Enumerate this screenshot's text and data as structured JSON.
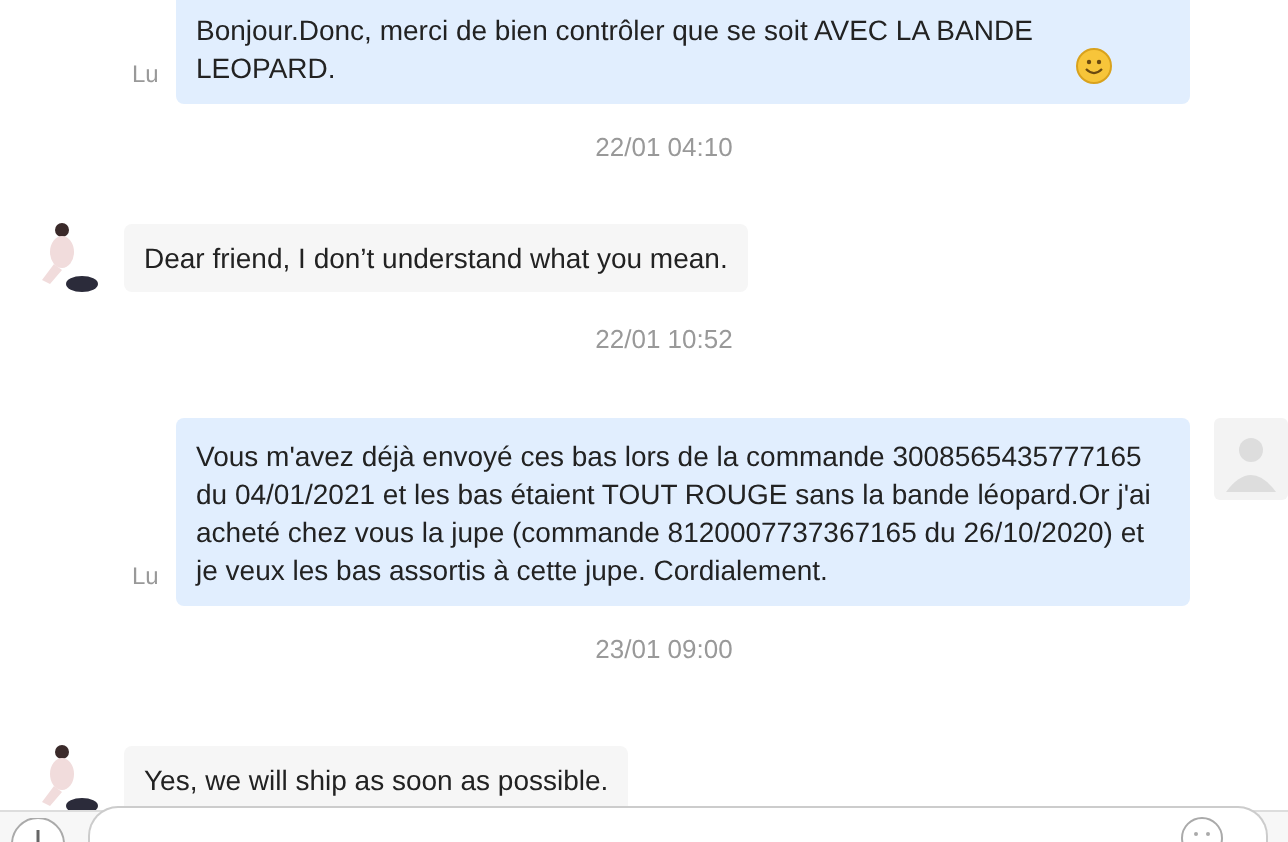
{
  "messages": [
    {
      "kind": "sent",
      "text": "Bonjour.Donc, merci de bien contrôler que se soit AVEC LA BANDE LEOPARD.",
      "emoji": true,
      "status": "Lu",
      "avatar": false
    },
    {
      "kind": "time",
      "text": "22/01 04:10"
    },
    {
      "kind": "received",
      "text": "Dear friend, I don’t understand what you mean."
    },
    {
      "kind": "time",
      "text": "22/01 10:52"
    },
    {
      "kind": "sent",
      "text": "Vous m'avez déjà envoyé ces bas lors de la commande 3008565435777165 du 04/01/2021 et les bas étaient TOUT ROUGE sans la bande léopard.Or j'ai acheté chez vous la jupe (commande 8120007737367165 du 26/10/2020) et je veux les bas assortis à cette jupe. Cordialement.",
      "emoji": false,
      "status": "Lu",
      "avatar": true
    },
    {
      "kind": "time",
      "text": "23/01 09:00"
    },
    {
      "kind": "received",
      "text": "Yes, we will ship as soon as possible."
    }
  ]
}
